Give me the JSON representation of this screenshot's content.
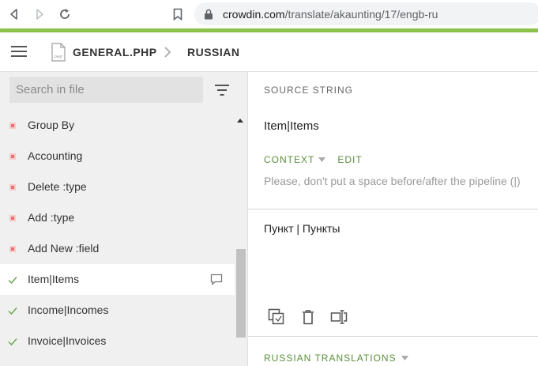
{
  "browser": {
    "url_host": "crowdin.com",
    "url_path": "/translate/akaunting/17/engb-ru"
  },
  "header": {
    "file_name": "GENERAL.PHP",
    "language": "RUSSIAN"
  },
  "sidebar": {
    "search_placeholder": "Search in file",
    "items": [
      {
        "label": "Group By",
        "status": "untranslated"
      },
      {
        "label": "Accounting",
        "status": "untranslated"
      },
      {
        "label": "Delete :type",
        "status": "untranslated"
      },
      {
        "label": "Add :type",
        "status": "untranslated"
      },
      {
        "label": "Add New :field",
        "status": "untranslated"
      },
      {
        "label": "Item|Items",
        "status": "translated",
        "active": true
      },
      {
        "label": "Income|Incomes",
        "status": "translated"
      },
      {
        "label": "Invoice|Invoices",
        "status": "translated"
      }
    ]
  },
  "main": {
    "source_header": "SOURCE STRING",
    "source_text": "Item|Items",
    "context_label": "CONTEXT",
    "edit_label": "EDIT",
    "context_text": "Please, don't put a space before/after the pipeline (|)",
    "translation_text": "Пункт | Пункты",
    "translations_header": "RUSSIAN TRANSLATIONS"
  },
  "colors": {
    "accent_green": "#8bc34a",
    "label_green": "#5a8f3d",
    "untranslated_red": "#e57373"
  }
}
